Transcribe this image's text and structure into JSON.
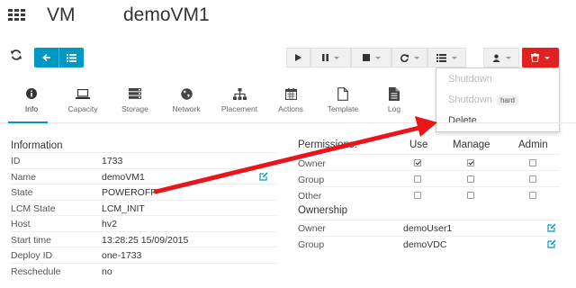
{
  "header": {
    "section": "VM",
    "vm_name": "demoVM1"
  },
  "dropdown": {
    "items": [
      {
        "label": "Shutdown",
        "enabled": false
      },
      {
        "label": "Shutdown",
        "badge": "hard",
        "enabled": false
      },
      {
        "label": "Delete",
        "enabled": true
      }
    ]
  },
  "tabs": [
    {
      "label": "Info",
      "icon": "info-icon",
      "active": true
    },
    {
      "label": "Capacity",
      "icon": "laptop-icon"
    },
    {
      "label": "Storage",
      "icon": "server-icon"
    },
    {
      "label": "Network",
      "icon": "globe-icon"
    },
    {
      "label": "Placement",
      "icon": "sitemap-icon"
    },
    {
      "label": "Actions",
      "icon": "calendar-icon"
    },
    {
      "label": "Template",
      "icon": "file-icon"
    },
    {
      "label": "Log",
      "icon": "file-text-icon"
    }
  ],
  "information": {
    "title": "Information",
    "rows": [
      {
        "key": "ID",
        "value": "1733"
      },
      {
        "key": "Name",
        "value": "demoVM1"
      },
      {
        "key": "State",
        "value": "POWEROFF"
      },
      {
        "key": "LCM State",
        "value": "LCM_INIT"
      },
      {
        "key": "Host",
        "value": "hv2"
      },
      {
        "key": "Start time",
        "value": "13:28:25 15/09/2015"
      },
      {
        "key": "Deploy ID",
        "value": "one-1733"
      },
      {
        "key": "Reschedule",
        "value": "no"
      }
    ]
  },
  "permissions": {
    "title": "Permissions:",
    "columns": [
      "Use",
      "Manage",
      "Admin"
    ],
    "rows": [
      {
        "key": "Owner",
        "use": true,
        "manage": true,
        "admin": false
      },
      {
        "key": "Group",
        "use": false,
        "manage": false,
        "admin": false
      },
      {
        "key": "Other",
        "use": false,
        "manage": false,
        "admin": false
      }
    ]
  },
  "ownership": {
    "title": "Ownership",
    "rows": [
      {
        "key": "Owner",
        "value": "demoUser1"
      },
      {
        "key": "Group",
        "value": "demoVDC"
      }
    ]
  },
  "colors": {
    "accent": "#0098c3",
    "danger": "#e0211f",
    "arrow": "#e8151b"
  }
}
